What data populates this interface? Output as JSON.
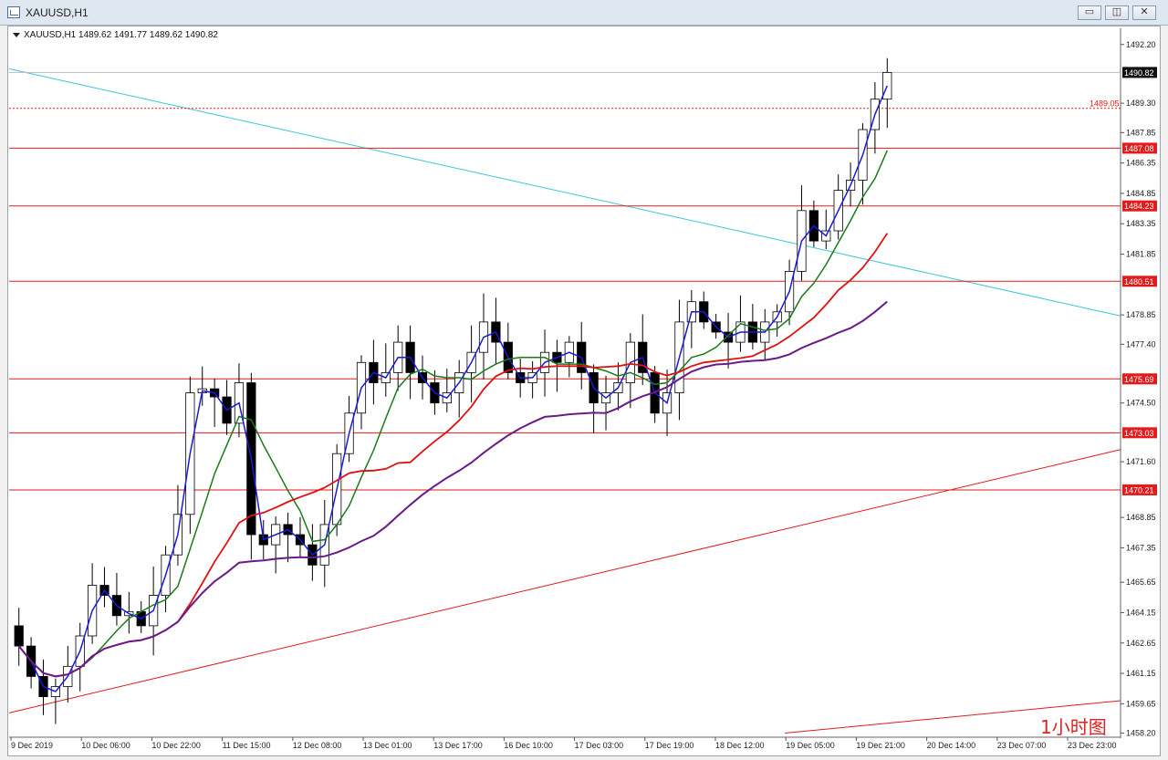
{
  "window": {
    "title": "XAUUSD,H1",
    "icon": "chart-window-icon",
    "buttons": [
      {
        "name": "minimize-button",
        "glyph": "▭"
      },
      {
        "name": "maximize-button",
        "glyph": "◫"
      },
      {
        "name": "close-button",
        "glyph": "✕"
      }
    ]
  },
  "chart": {
    "info_line": "XAUUSD,H1  1489.62 1491.77 1489.62 1490.82",
    "watermark": "1小时图",
    "current_price_label": "1490.82",
    "dashed_level_label": "1489.05",
    "colors": {
      "bullish": "#ffffff",
      "bearish": "#000000",
      "level_line": "#e31b1b",
      "trend_cyan": "#38c8d8",
      "ma_blue": "#1a1ad6",
      "ma_green": "#1b7a1b",
      "ma_red": "#e01010",
      "ma_purple": "#6a1a8a"
    }
  },
  "chart_data": {
    "type": "candlestick",
    "symbol": "XAUUSD",
    "timeframe": "H1",
    "x_tick_labels": [
      "9 Dec 2019",
      "10 Dec 06:00",
      "10 Dec 22:00",
      "11 Dec 15:00",
      "12 Dec 08:00",
      "13 Dec 01:00",
      "13 Dec 17:00",
      "16 Dec 10:00",
      "17 Dec 03:00",
      "17 Dec 19:00",
      "18 Dec 12:00",
      "19 Dec 05:00",
      "19 Dec 21:00",
      "20 Dec 14:00",
      "23 Dec 07:00",
      "23 Dec 23:00"
    ],
    "y_tick_labels": [
      "1492.20",
      "1489.30",
      "1487.85",
      "1486.35",
      "1484.85",
      "1483.35",
      "1481.85",
      "1478.85",
      "1477.40",
      "1474.50",
      "1471.60",
      "1468.85",
      "1467.35",
      "1465.65",
      "1464.15",
      "1462.65",
      "1461.15",
      "1459.65",
      "1458.20"
    ],
    "ylim": [
      1458.0,
      1493.0
    ],
    "horizontal_levels": [
      1487.08,
      1484.23,
      1480.51,
      1475.69,
      1473.03,
      1470.21
    ],
    "current_price": 1490.82,
    "dashed_level": 1489.05,
    "ohlc_last": {
      "open": 1489.62,
      "high": 1491.77,
      "low": 1489.62,
      "close": 1490.82
    },
    "closes": [
      1462.5,
      1461.0,
      1460.0,
      1460.5,
      1461.5,
      1463.0,
      1465.5,
      1465.0,
      1464.0,
      1464.2,
      1463.5,
      1465.0,
      1467.0,
      1469.0,
      1475.0,
      1475.2,
      1474.8,
      1473.5,
      1475.5,
      1468.0,
      1467.5,
      1468.5,
      1468.0,
      1467.5,
      1466.5,
      1468.5,
      1472.0,
      1474.0,
      1476.5,
      1475.5,
      1476.0,
      1477.5,
      1476.0,
      1475.5,
      1474.5,
      1475.0,
      1476.0,
      1477.0,
      1478.5,
      1477.5,
      1476.0,
      1475.5,
      1476.0,
      1477.0,
      1476.5,
      1477.5,
      1476.0,
      1474.5,
      1475.0,
      1475.5,
      1477.5,
      1476.0,
      1474.0,
      1475.0,
      1478.5,
      1479.5,
      1478.5,
      1478.0,
      1477.5,
      1478.5,
      1477.5,
      1478.5,
      1479.0,
      1481.0,
      1484.0,
      1482.5,
      1483.0,
      1485.0,
      1485.5,
      1488.0,
      1489.5,
      1490.82
    ]
  }
}
